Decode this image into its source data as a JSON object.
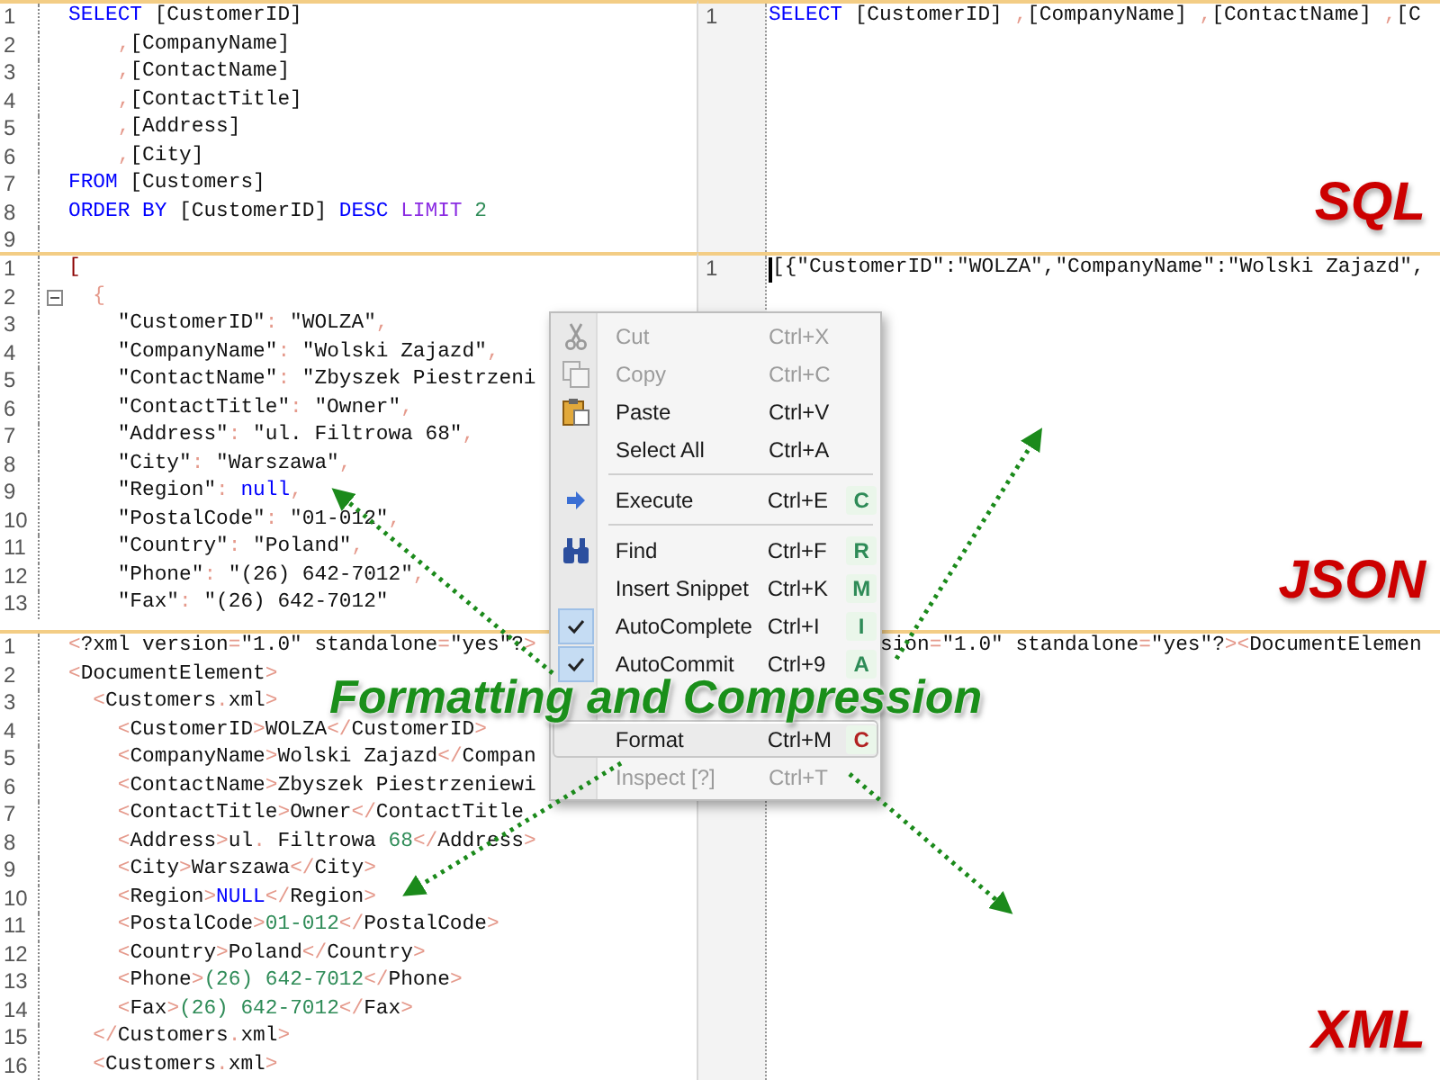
{
  "panes": [
    {
      "label": "SQL",
      "left": {
        "lines": [
          {
            "number": "1",
            "tokens": [
              {
                "kind": "kw",
                "text": "SELECT"
              },
              {
                "kind": "tx",
                "text": " [CustomerID]"
              }
            ]
          },
          {
            "number": "2",
            "tokens": [
              {
                "kind": "pu",
                "text": "    ,"
              },
              {
                "kind": "tx",
                "text": "[CompanyName]"
              }
            ]
          },
          {
            "number": "3",
            "tokens": [
              {
                "kind": "pu",
                "text": "    ,"
              },
              {
                "kind": "tx",
                "text": "[ContactName]"
              }
            ]
          },
          {
            "number": "4",
            "tokens": [
              {
                "kind": "pu",
                "text": "    ,"
              },
              {
                "kind": "tx",
                "text": "[ContactTitle]"
              }
            ]
          },
          {
            "number": "5",
            "tokens": [
              {
                "kind": "pu",
                "text": "    ,"
              },
              {
                "kind": "tx",
                "text": "[Address]"
              }
            ]
          },
          {
            "number": "6",
            "tokens": [
              {
                "kind": "pu",
                "text": "    ,"
              },
              {
                "kind": "tx",
                "text": "[City]"
              }
            ]
          },
          {
            "number": "7",
            "tokens": [
              {
                "kind": "kw",
                "text": "FROM"
              },
              {
                "kind": "tx",
                "text": " [Customers]"
              }
            ]
          },
          {
            "number": "8",
            "tokens": [
              {
                "kind": "kw",
                "text": "ORDER BY"
              },
              {
                "kind": "tx",
                "text": " [CustomerID] "
              },
              {
                "kind": "kw",
                "text": "DESC"
              },
              {
                "kind": "fn",
                "text": " LIMIT"
              },
              {
                "kind": "nu",
                "text": " 2"
              }
            ]
          },
          {
            "number": "9"
          }
        ]
      },
      "right": {
        "line_number": "1",
        "cursor": false,
        "tokens": [
          {
            "kind": "kw",
            "text": "SELECT"
          },
          {
            "kind": "tx",
            "text": " [CustomerID] "
          },
          {
            "kind": "pu",
            "text": ","
          },
          {
            "kind": "tx",
            "text": "[CompanyName] "
          },
          {
            "kind": "pu",
            "text": ","
          },
          {
            "kind": "tx",
            "text": "[ContactName] "
          },
          {
            "kind": "pu",
            "text": ","
          },
          {
            "kind": "tx",
            "text": "[C"
          }
        ]
      }
    },
    {
      "label": "JSON",
      "left": {
        "lines": [
          {
            "number": "1",
            "tokens": [
              {
                "kind": "br",
                "text": "["
              }
            ]
          },
          {
            "number": "2",
            "fold": true,
            "tokens": [
              {
                "kind": "pu",
                "text": "  {"
              }
            ]
          },
          {
            "number": "3",
            "tokens": [
              {
                "kind": "tx",
                "text": "    \"CustomerID\""
              },
              {
                "kind": "pu",
                "text": ":"
              },
              {
                "kind": "tx",
                "text": " \"WOLZA\""
              },
              {
                "kind": "pu",
                "text": ","
              }
            ]
          },
          {
            "number": "4",
            "tokens": [
              {
                "kind": "tx",
                "text": "    \"CompanyName\""
              },
              {
                "kind": "pu",
                "text": ":"
              },
              {
                "kind": "tx",
                "text": " \"Wolski Zajazd\""
              },
              {
                "kind": "pu",
                "text": ","
              }
            ]
          },
          {
            "number": "5",
            "tokens": [
              {
                "kind": "tx",
                "text": "    \"ContactName\""
              },
              {
                "kind": "pu",
                "text": ":"
              },
              {
                "kind": "tx",
                "text": " \"Zbyszek Piestrzeni"
              }
            ]
          },
          {
            "number": "6",
            "tokens": [
              {
                "kind": "tx",
                "text": "    \"ContactTitle\""
              },
              {
                "kind": "pu",
                "text": ":"
              },
              {
                "kind": "tx",
                "text": " \"Owner\""
              },
              {
                "kind": "pu",
                "text": ","
              }
            ]
          },
          {
            "number": "7",
            "tokens": [
              {
                "kind": "tx",
                "text": "    \"Address\""
              },
              {
                "kind": "pu",
                "text": ":"
              },
              {
                "kind": "tx",
                "text": " \"ul. Filtrowa 68\""
              },
              {
                "kind": "pu",
                "text": ","
              }
            ]
          },
          {
            "number": "8",
            "tokens": [
              {
                "kind": "tx",
                "text": "    \"City\""
              },
              {
                "kind": "pu",
                "text": ":"
              },
              {
                "kind": "tx",
                "text": " \"Warszawa\""
              },
              {
                "kind": "pu",
                "text": ","
              }
            ]
          },
          {
            "number": "9",
            "tokens": [
              {
                "kind": "tx",
                "text": "    \"Region\""
              },
              {
                "kind": "pu",
                "text": ":"
              },
              {
                "kind": "kw",
                "text": " null"
              },
              {
                "kind": "pu",
                "text": ","
              }
            ]
          },
          {
            "number": "10",
            "tokens": [
              {
                "kind": "tx",
                "text": "    \"PostalCode\""
              },
              {
                "kind": "pu",
                "text": ":"
              },
              {
                "kind": "tx",
                "text": " \"01-012\""
              },
              {
                "kind": "pu",
                "text": ","
              }
            ]
          },
          {
            "number": "11",
            "tokens": [
              {
                "kind": "tx",
                "text": "    \"Country\""
              },
              {
                "kind": "pu",
                "text": ":"
              },
              {
                "kind": "tx",
                "text": " \"Poland\""
              },
              {
                "kind": "pu",
                "text": ","
              }
            ]
          },
          {
            "number": "12",
            "tokens": [
              {
                "kind": "tx",
                "text": "    \"Phone\""
              },
              {
                "kind": "pu",
                "text": ":"
              },
              {
                "kind": "tx",
                "text": " \"(26) 642-7012\""
              },
              {
                "kind": "pu",
                "text": ","
              }
            ]
          },
          {
            "number": "13",
            "tokens": [
              {
                "kind": "tx",
                "text": "    \"Fax\""
              },
              {
                "kind": "pu",
                "text": ":"
              },
              {
                "kind": "tx",
                "text": " \"(26) 642-7012\""
              }
            ]
          }
        ]
      },
      "right": {
        "line_number": "1",
        "cursor": true,
        "tokens": [
          {
            "kind": "tx",
            "text": "[{\"CustomerID\":\"WOLZA\",\"CompanyName\":\"Wolski Zajazd\","
          }
        ]
      }
    },
    {
      "label": "XML",
      "left": {
        "lines": [
          {
            "number": "1",
            "tokens": [
              {
                "kind": "pu",
                "text": "<"
              },
              {
                "kind": "tx",
                "text": "?xml version"
              },
              {
                "kind": "pu",
                "text": "="
              },
              {
                "kind": "tx",
                "text": "\"1.0\" standalone"
              },
              {
                "kind": "pu",
                "text": "="
              },
              {
                "kind": "tx",
                "text": "\"yes\"?"
              },
              {
                "kind": "pu",
                "text": ">"
              }
            ]
          },
          {
            "number": "2",
            "tokens": [
              {
                "kind": "pu",
                "text": "<"
              },
              {
                "kind": "tx",
                "text": "DocumentElement"
              },
              {
                "kind": "pu",
                "text": ">"
              }
            ]
          },
          {
            "number": "3",
            "tokens": [
              {
                "kind": "pu",
                "text": "  <"
              },
              {
                "kind": "tx",
                "text": "Customers"
              },
              {
                "kind": "pu",
                "text": "."
              },
              {
                "kind": "tx",
                "text": "xml"
              },
              {
                "kind": "pu",
                "text": ">"
              }
            ]
          },
          {
            "number": "4",
            "tokens": [
              {
                "kind": "pu",
                "text": "    <"
              },
              {
                "kind": "tx",
                "text": "CustomerID"
              },
              {
                "kind": "pu",
                "text": ">"
              },
              {
                "kind": "tx",
                "text": "WOLZA"
              },
              {
                "kind": "pu",
                "text": "</"
              },
              {
                "kind": "tx",
                "text": "CustomerID"
              },
              {
                "kind": "pu",
                "text": ">"
              }
            ]
          },
          {
            "number": "5",
            "tokens": [
              {
                "kind": "pu",
                "text": "    <"
              },
              {
                "kind": "tx",
                "text": "CompanyName"
              },
              {
                "kind": "pu",
                "text": ">"
              },
              {
                "kind": "tx",
                "text": "Wolski Zajazd"
              },
              {
                "kind": "pu",
                "text": "</"
              },
              {
                "kind": "tx",
                "text": "Compan"
              }
            ]
          },
          {
            "number": "6",
            "tokens": [
              {
                "kind": "pu",
                "text": "    <"
              },
              {
                "kind": "tx",
                "text": "ContactName"
              },
              {
                "kind": "pu",
                "text": ">"
              },
              {
                "kind": "tx",
                "text": "Zbyszek Piestrzeniewi"
              }
            ]
          },
          {
            "number": "7",
            "tokens": [
              {
                "kind": "pu",
                "text": "    <"
              },
              {
                "kind": "tx",
                "text": "ContactTitle"
              },
              {
                "kind": "pu",
                "text": ">"
              },
              {
                "kind": "tx",
                "text": "Owner"
              },
              {
                "kind": "pu",
                "text": "</"
              },
              {
                "kind": "tx",
                "text": "ContactTitle"
              }
            ]
          },
          {
            "number": "8",
            "tokens": [
              {
                "kind": "pu",
                "text": "    <"
              },
              {
                "kind": "tx",
                "text": "Address"
              },
              {
                "kind": "pu",
                "text": ">"
              },
              {
                "kind": "tx",
                "text": "ul"
              },
              {
                "kind": "pu",
                "text": "."
              },
              {
                "kind": "tx",
                "text": " Filtrowa "
              },
              {
                "kind": "nu",
                "text": "68"
              },
              {
                "kind": "pu",
                "text": "</"
              },
              {
                "kind": "tx",
                "text": "Address"
              },
              {
                "kind": "pu",
                "text": ">"
              }
            ]
          },
          {
            "number": "9",
            "tokens": [
              {
                "kind": "pu",
                "text": "    <"
              },
              {
                "kind": "tx",
                "text": "City"
              },
              {
                "kind": "pu",
                "text": ">"
              },
              {
                "kind": "tx",
                "text": "Warszawa"
              },
              {
                "kind": "pu",
                "text": "</"
              },
              {
                "kind": "tx",
                "text": "City"
              },
              {
                "kind": "pu",
                "text": ">"
              }
            ]
          },
          {
            "number": "10",
            "tokens": [
              {
                "kind": "pu",
                "text": "    <"
              },
              {
                "kind": "tx",
                "text": "Region"
              },
              {
                "kind": "pu",
                "text": ">"
              },
              {
                "kind": "kw",
                "text": "NULL"
              },
              {
                "kind": "pu",
                "text": "</"
              },
              {
                "kind": "tx",
                "text": "Region"
              },
              {
                "kind": "pu",
                "text": ">"
              }
            ]
          },
          {
            "number": "11",
            "tokens": [
              {
                "kind": "pu",
                "text": "    <"
              },
              {
                "kind": "tx",
                "text": "PostalCode"
              },
              {
                "kind": "pu",
                "text": ">"
              },
              {
                "kind": "nu",
                "text": "01-012"
              },
              {
                "kind": "pu",
                "text": "</"
              },
              {
                "kind": "tx",
                "text": "PostalCode"
              },
              {
                "kind": "pu",
                "text": ">"
              }
            ]
          },
          {
            "number": "12",
            "tokens": [
              {
                "kind": "pu",
                "text": "    <"
              },
              {
                "kind": "tx",
                "text": "Country"
              },
              {
                "kind": "pu",
                "text": ">"
              },
              {
                "kind": "tx",
                "text": "Poland"
              },
              {
                "kind": "pu",
                "text": "</"
              },
              {
                "kind": "tx",
                "text": "Country"
              },
              {
                "kind": "pu",
                "text": ">"
              }
            ]
          },
          {
            "number": "13",
            "tokens": [
              {
                "kind": "pu",
                "text": "    <"
              },
              {
                "kind": "tx",
                "text": "Phone"
              },
              {
                "kind": "pu",
                "text": ">"
              },
              {
                "kind": "nu",
                "text": "(26) 642-7012"
              },
              {
                "kind": "pu",
                "text": "</"
              },
              {
                "kind": "tx",
                "text": "Phone"
              },
              {
                "kind": "pu",
                "text": ">"
              }
            ]
          },
          {
            "number": "14",
            "tokens": [
              {
                "kind": "pu",
                "text": "    <"
              },
              {
                "kind": "tx",
                "text": "Fax"
              },
              {
                "kind": "pu",
                "text": ">"
              },
              {
                "kind": "nu",
                "text": "(26) 642-7012"
              },
              {
                "kind": "pu",
                "text": "</"
              },
              {
                "kind": "tx",
                "text": "Fax"
              },
              {
                "kind": "pu",
                "text": ">"
              }
            ]
          },
          {
            "number": "15",
            "tokens": [
              {
                "kind": "pu",
                "text": "  </"
              },
              {
                "kind": "tx",
                "text": "Customers"
              },
              {
                "kind": "pu",
                "text": "."
              },
              {
                "kind": "tx",
                "text": "xml"
              },
              {
                "kind": "pu",
                "text": ">"
              }
            ]
          },
          {
            "number": "16",
            "tokens": [
              {
                "kind": "pu",
                "text": "  <"
              },
              {
                "kind": "tx",
                "text": "Customers"
              },
              {
                "kind": "pu",
                "text": "."
              },
              {
                "kind": "tx",
                "text": "xml"
              },
              {
                "kind": "pu",
                "text": ">"
              }
            ]
          }
        ]
      },
      "right": {
        "cursor": false,
        "tokens": [
          {
            "kind": "tx",
            "text": "sion"
          },
          {
            "kind": "pu",
            "text": "="
          },
          {
            "kind": "tx",
            "text": "\"1.0\" standalone"
          },
          {
            "kind": "pu",
            "text": "="
          },
          {
            "kind": "tx",
            "text": "\"yes\"?"
          },
          {
            "kind": "pu",
            "text": "><"
          },
          {
            "kind": "tx",
            "text": "DocumentElemen"
          }
        ]
      }
    }
  ],
  "context_menu": [
    {
      "kind": "item",
      "label": "Cut",
      "shortcut": "Ctrl+X",
      "disabled": true,
      "checked": false,
      "selected": false
    },
    {
      "kind": "item",
      "label": "Copy",
      "shortcut": "Ctrl+C",
      "disabled": true,
      "checked": false,
      "selected": false
    },
    {
      "kind": "item",
      "label": "Paste",
      "shortcut": "Ctrl+V",
      "disabled": false,
      "checked": false,
      "selected": false
    },
    {
      "kind": "item",
      "label": "Select All",
      "shortcut": "Ctrl+A",
      "disabled": false,
      "checked": false,
      "selected": false
    },
    {
      "kind": "separator"
    },
    {
      "kind": "item",
      "label": "Execute",
      "shortcut": "Ctrl+E",
      "badge": "C",
      "color": "#2e8b57",
      "disabled": false,
      "checked": false,
      "selected": false
    },
    {
      "kind": "separator"
    },
    {
      "kind": "item",
      "label": "Find",
      "shortcut": "Ctrl+F",
      "badge": "R",
      "color": "#2e8b57",
      "disabled": false,
      "checked": false,
      "selected": false
    },
    {
      "kind": "item",
      "label": "Insert Snippet",
      "shortcut": "Ctrl+K",
      "badge": "M",
      "color": "#2e8b57",
      "disabled": false,
      "checked": false,
      "selected": false
    },
    {
      "kind": "item",
      "label": "AutoComplete",
      "shortcut": "Ctrl+I",
      "badge": "I",
      "color": "#2e8b57",
      "disabled": false,
      "checked": true,
      "selected": false
    },
    {
      "kind": "item",
      "label": "AutoCommit",
      "shortcut": "Ctrl+9",
      "badge": "A",
      "color": "#2e8b57",
      "disabled": false,
      "checked": true,
      "selected": false
    },
    {
      "kind": "covered"
    },
    {
      "kind": "item",
      "label": "Format",
      "shortcut": "Ctrl+M",
      "badge": "C",
      "color": "#b22222",
      "disabled": false,
      "checked": false,
      "selected": true
    },
    {
      "kind": "item",
      "label": "Inspect [?]",
      "shortcut": "Ctrl+T",
      "disabled": true,
      "checked": false,
      "selected": false
    }
  ],
  "headline": "Formatting and Compression"
}
